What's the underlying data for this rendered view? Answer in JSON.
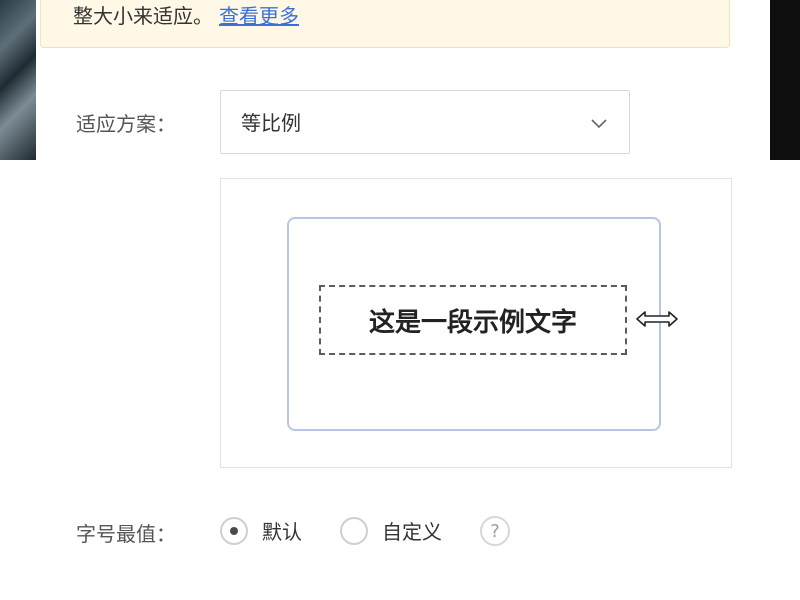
{
  "notice": {
    "text": "整大小来适应。",
    "link": "查看更多"
  },
  "fit_scheme": {
    "label": "适应方案：",
    "selected": "等比例",
    "icon": "chevron-down-icon"
  },
  "preview": {
    "sample_text": "这是一段示例文字",
    "handle_icon": "resize-horizontal-icon"
  },
  "font_size_limit": {
    "label": "字号最值：",
    "options": [
      {
        "label": "默认",
        "checked": true
      },
      {
        "label": "自定义",
        "checked": false
      }
    ],
    "help_icon": "question-icon",
    "help_text": "?"
  },
  "colors": {
    "accent": "#3d6fd8",
    "notice_bg": "#fff8e6",
    "preview_border": "#b7c6e2"
  }
}
